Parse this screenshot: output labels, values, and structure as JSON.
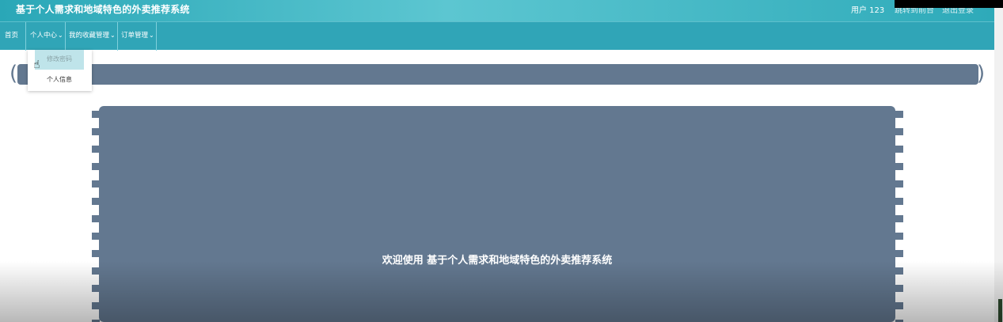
{
  "header": {
    "title": "基于个人需求和地域特色的外卖推荐系统",
    "user": "用户 123",
    "link_home": "跳转到前台",
    "link_logout": "退出登录"
  },
  "nav": {
    "items": [
      {
        "label": "首页"
      },
      {
        "label": "个人中心"
      },
      {
        "label": "我的收藏管理"
      },
      {
        "label": "订单管理"
      }
    ],
    "chevron": "chevron-down-icon"
  },
  "dropdown": {
    "items": [
      {
        "label": "修改密码"
      },
      {
        "label": "个人信息"
      }
    ]
  },
  "main": {
    "welcome": "欢迎使用 基于个人需求和地域特色的外卖推荐系统"
  },
  "colors": {
    "topbar": "#2aa7b7",
    "navbar": "#30a5b7",
    "card": "#637890"
  }
}
